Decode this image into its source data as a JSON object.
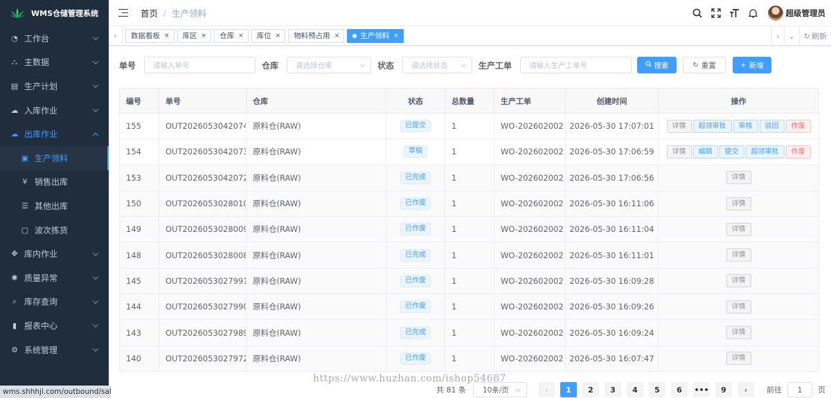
{
  "app": {
    "title": "WMS仓储管理系统",
    "status_url": "wms.shhhji.com/outbound/sales"
  },
  "sidebar": {
    "items": [
      {
        "label": "工作台",
        "icon": "dashboard-icon"
      },
      {
        "label": "主数据",
        "icon": "sitemap-icon"
      },
      {
        "label": "生产计划",
        "icon": "clipboard-icon"
      },
      {
        "label": "入库作业",
        "icon": "cloud-upload-icon"
      },
      {
        "label": "出库作业",
        "icon": "cloud-download-icon"
      },
      {
        "label": "库内作业",
        "icon": "move-icon"
      },
      {
        "label": "质量异常",
        "icon": "bug-icon"
      },
      {
        "label": "库存查询",
        "icon": "search-icon"
      },
      {
        "label": "报表中心",
        "icon": "bar-chart-icon"
      },
      {
        "label": "系统管理",
        "icon": "gear-icon"
      }
    ],
    "outbound_sub": [
      {
        "label": "生产领料",
        "icon": "briefcase-icon"
      },
      {
        "label": "销售出库",
        "icon": "yen-icon"
      },
      {
        "label": "其他出库",
        "icon": "list-icon"
      },
      {
        "label": "波次拣货",
        "icon": "box-icon"
      }
    ]
  },
  "header": {
    "breadcrumb_home": "首页",
    "breadcrumb_current": "生产领料",
    "username": "超级管理员"
  },
  "tags": {
    "items": [
      "数据看板",
      "库区",
      "仓库",
      "库位",
      "物料预占用",
      "生产领料"
    ],
    "refresh_label": "刷新"
  },
  "search": {
    "order_no_label": "单号",
    "order_no_placeholder": "请输入单号",
    "warehouse_label": "仓库",
    "warehouse_placeholder": "请选择仓库",
    "status_label": "状态",
    "status_placeholder": "请选择状态",
    "work_order_label": "生产工单",
    "work_order_placeholder": "请输入生产工单号",
    "search_button": "搜索",
    "reset_button": "重置",
    "add_button": "新增"
  },
  "table": {
    "columns": [
      "编号",
      "单号",
      "仓库",
      "状态",
      "总数量",
      "生产工单",
      "创建时间",
      "操作"
    ],
    "rows": [
      {
        "id": "155",
        "no": "OUT2026053042074",
        "warehouse": "原料仓(RAW)",
        "status": "已提交",
        "qty": "1",
        "wo": "WO-202602002",
        "created": "2026-05-30 17:07:01",
        "actions": [
          {
            "label": "详情",
            "type": "info"
          },
          {
            "label": "超领审批",
            "type": "primary"
          },
          {
            "label": "审核",
            "type": "primary"
          },
          {
            "label": "驳回",
            "type": "primary"
          },
          {
            "label": "作废",
            "type": "danger"
          }
        ]
      },
      {
        "id": "154",
        "no": "OUT2026053042073",
        "warehouse": "原料仓(RAW)",
        "status": "草稿",
        "qty": "1",
        "wo": "WO-202602002",
        "created": "2026-05-30 17:06:59",
        "actions": [
          {
            "label": "详情",
            "type": "info"
          },
          {
            "label": "编辑",
            "type": "primary"
          },
          {
            "label": "提交",
            "type": "primary"
          },
          {
            "label": "超领审批",
            "type": "primary"
          },
          {
            "label": "作废",
            "type": "danger"
          }
        ]
      },
      {
        "id": "153",
        "no": "OUT2026053042072",
        "warehouse": "原料仓(RAW)",
        "status": "已完成",
        "qty": "1",
        "wo": "WO-202602002",
        "created": "2026-05-30 17:06:56",
        "actions": [
          {
            "label": "详情",
            "type": "info"
          }
        ]
      },
      {
        "id": "150",
        "no": "OUT2026053028010",
        "warehouse": "原料仓(RAW)",
        "status": "已作废",
        "qty": "1",
        "wo": "WO-202602002",
        "created": "2026-05-30 16:11:06",
        "actions": [
          {
            "label": "详情",
            "type": "info"
          }
        ]
      },
      {
        "id": "149",
        "no": "OUT2026053028009",
        "warehouse": "原料仓(RAW)",
        "status": "已作废",
        "qty": "1",
        "wo": "WO-202602002",
        "created": "2026-05-30 16:11:04",
        "actions": [
          {
            "label": "详情",
            "type": "info"
          }
        ]
      },
      {
        "id": "148",
        "no": "OUT2026053028008",
        "warehouse": "原料仓(RAW)",
        "status": "已完成",
        "qty": "1",
        "wo": "WO-202602002",
        "created": "2026-05-30 16:11:01",
        "actions": [
          {
            "label": "详情",
            "type": "info"
          }
        ]
      },
      {
        "id": "145",
        "no": "OUT2026053027991",
        "warehouse": "原料仓(RAW)",
        "status": "已作废",
        "qty": "1",
        "wo": "WO-202602002",
        "created": "2026-05-30 16:09:28",
        "actions": [
          {
            "label": "详情",
            "type": "info"
          }
        ]
      },
      {
        "id": "144",
        "no": "OUT2026053027990",
        "warehouse": "原料仓(RAW)",
        "status": "已作废",
        "qty": "1",
        "wo": "WO-202602002",
        "created": "2026-05-30 16:09:26",
        "actions": [
          {
            "label": "详情",
            "type": "info"
          }
        ]
      },
      {
        "id": "143",
        "no": "OUT2026053027989",
        "warehouse": "原料仓(RAW)",
        "status": "已完成",
        "qty": "1",
        "wo": "WO-202602002",
        "created": "2026-05-30 16:09:24",
        "actions": [
          {
            "label": "详情",
            "type": "info"
          }
        ]
      },
      {
        "id": "140",
        "no": "OUT2026053027972",
        "warehouse": "原料仓(RAW)",
        "status": "已作废",
        "qty": "1",
        "wo": "WO-202602002",
        "created": "2026-05-30 16:07:47",
        "actions": [
          {
            "label": "详情",
            "type": "info"
          }
        ]
      }
    ]
  },
  "pagination": {
    "total_text": "共 81 条",
    "page_size": "10条/页",
    "pages": [
      "1",
      "2",
      "3",
      "4",
      "5",
      "6",
      "•••",
      "9"
    ],
    "current": "1",
    "goto_label": "前往",
    "goto_value": "1",
    "goto_suffix": "页"
  },
  "watermark": "https://www.huzhan.com/ishop54687",
  "colors": {
    "primary": "#409eff",
    "sidebar_bg": "#1f2d3d",
    "danger": "#f56c6c"
  }
}
